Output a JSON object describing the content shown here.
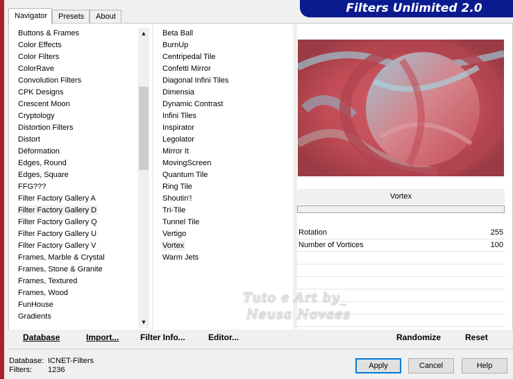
{
  "app": {
    "title": "Filters Unlimited 2.0"
  },
  "tabs": [
    "Navigator",
    "Presets",
    "About"
  ],
  "categories": [
    "Buttons & Frames",
    "Color Effects",
    "Color Filters",
    "ColorRave",
    "Convolution Filters",
    "CPK Designs",
    "Crescent Moon",
    "Cryptology",
    "Distortion Filters",
    "Distort",
    "Déformation",
    "Edges, Round",
    "Edges, Square",
    "FFG???",
    "Filter Factory Gallery A",
    "Filter Factory Gallery D",
    "Filter Factory Gallery Q",
    "Filter Factory Gallery U",
    "Filter Factory Gallery V",
    "Frames, Marble & Crystal",
    "Frames, Stone & Granite",
    "Frames, Textured",
    "Frames, Wood",
    "FunHouse",
    "Gradients"
  ],
  "selected_category": "Filter Factory Gallery D",
  "filters": [
    "Beta Ball",
    "BurnUp",
    "Centripedal Tile",
    "Confetti Mirror",
    "Diagonal Infini Tiles",
    "Dimensia",
    "Dynamic Contrast",
    "Infini Tiles",
    "Inspirator",
    "Legolator",
    "Mirror It",
    "MovingScreen",
    "Quantum Tile",
    "Ring Tile",
    "Shoutin'!",
    "Tri-Tile",
    "Tunnel Tile",
    "Vertigo",
    "Vortex",
    "Warm Jets"
  ],
  "selected_filter": "Vortex",
  "preview": {
    "filter_name": "Vortex"
  },
  "params": [
    {
      "name": "Rotation",
      "value": "255"
    },
    {
      "name": "Number of Vortices",
      "value": "100"
    }
  ],
  "toolbar": {
    "database": "Database",
    "import": "Import...",
    "filter_info": "Filter Info...",
    "editor": "Editor...",
    "randomize": "Randomize",
    "reset": "Reset"
  },
  "footer": {
    "database_label": "Database:",
    "database_value": "ICNET-Filters",
    "filters_label": "Filters:",
    "filters_value": "1236"
  },
  "buttons": {
    "apply": "Apply",
    "cancel": "Cancel",
    "help": "Help"
  },
  "watermark": {
    "line1": "Tuto e Art by_",
    "line2": "Neusa Novaes"
  },
  "colors": {
    "banner": "#0a1a8f",
    "accent": "#0078d7",
    "preview": "#c85259"
  }
}
